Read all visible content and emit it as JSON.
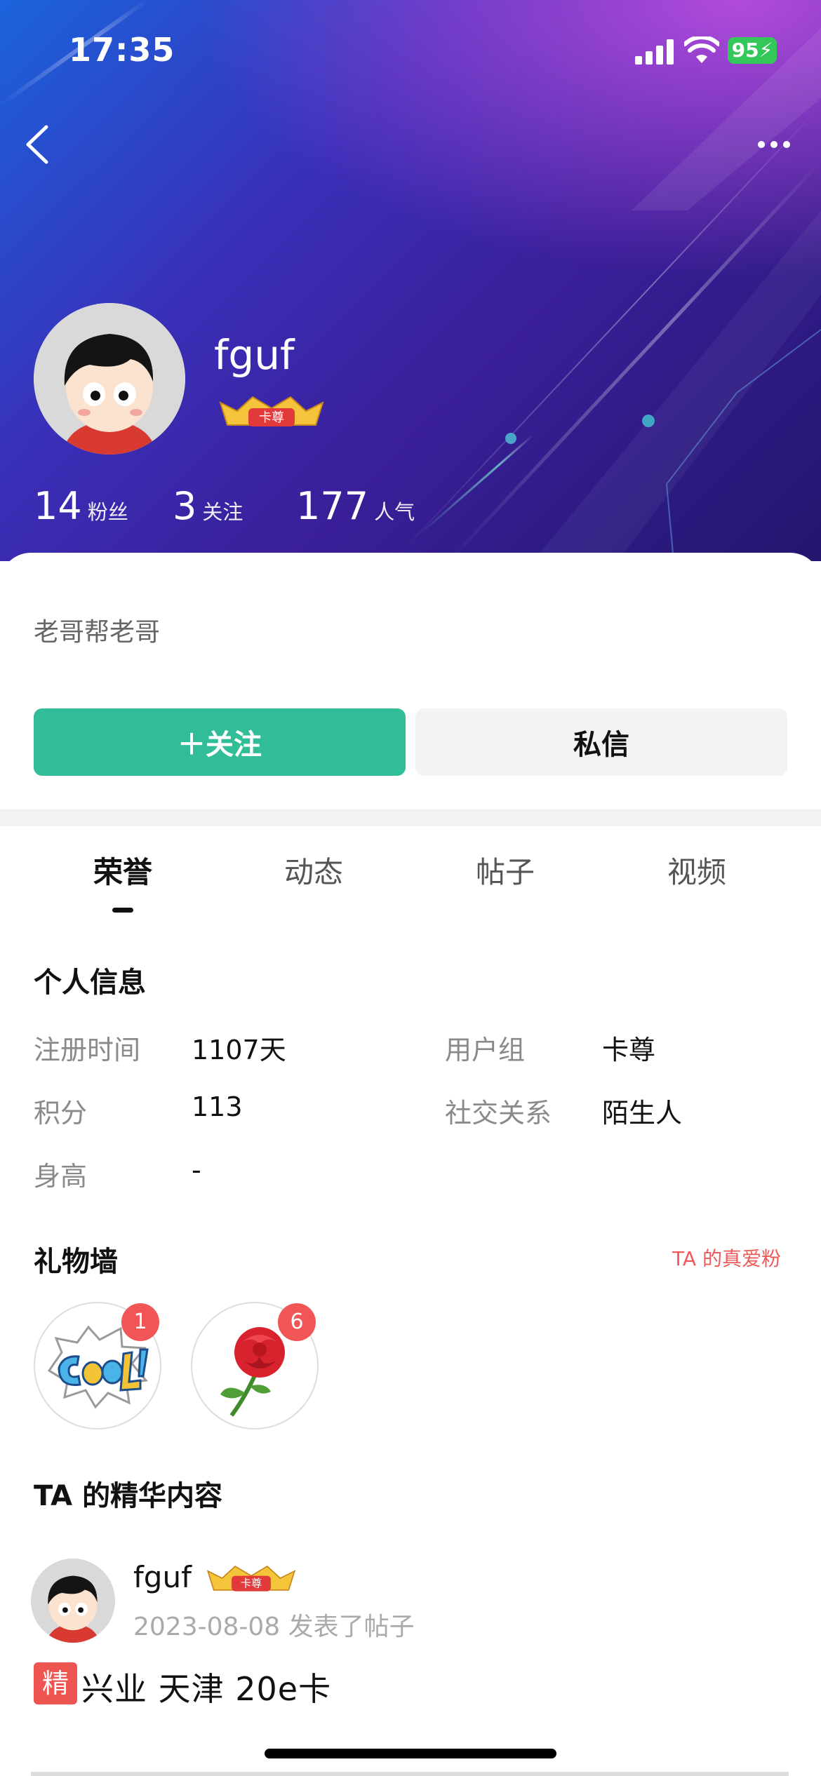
{
  "status_bar": {
    "time": "17:35",
    "battery": "95"
  },
  "profile": {
    "username": "fguf",
    "badge": "卡尊",
    "stats": [
      {
        "value": "14",
        "label": "粉丝"
      },
      {
        "value": "3",
        "label": "关注"
      },
      {
        "value": "177",
        "label": "人气"
      }
    ],
    "bio": "老哥帮老哥"
  },
  "actions": {
    "follow": "＋关注",
    "message": "私信"
  },
  "tabs": [
    {
      "label": "荣誉",
      "active": true
    },
    {
      "label": "动态",
      "active": false
    },
    {
      "label": "帖子",
      "active": false
    },
    {
      "label": "视频",
      "active": false
    }
  ],
  "personal_info": {
    "title": "个人信息",
    "rows": [
      {
        "key": "注册时间",
        "value": "1107天"
      },
      {
        "key": "用户组",
        "value": "卡尊"
      },
      {
        "key": "积分",
        "value": "113"
      },
      {
        "key": "社交关系",
        "value": "陌生人"
      },
      {
        "key": "身高",
        "value": "-"
      }
    ]
  },
  "gift_wall": {
    "title": "礼物墙",
    "link": "TA 的真爱粉",
    "gifts": [
      {
        "icon": "cool-sticker-icon",
        "count": "1"
      },
      {
        "icon": "rose-icon",
        "count": "6"
      }
    ]
  },
  "featured": {
    "title": "TA 的精华内容",
    "post": {
      "user": "fguf",
      "badge": "卡尊",
      "meta": "2023-08-08 发表了帖子",
      "tag": "精",
      "title": "兴业  天津  20e卡"
    }
  },
  "colors": {
    "accent_green": "#31bd97",
    "tag_red": "#ee5450",
    "link_red": "#ef5a5a"
  }
}
